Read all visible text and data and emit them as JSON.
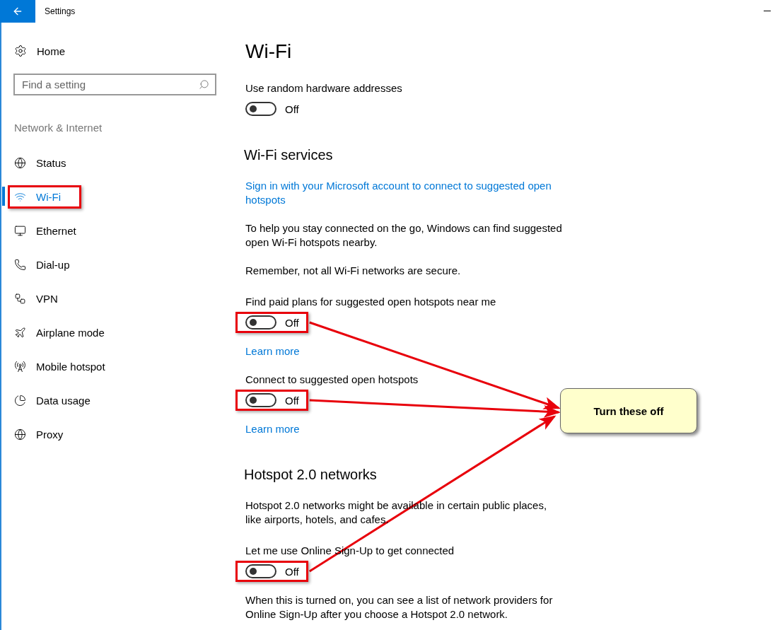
{
  "window": {
    "title": "Settings"
  },
  "sidebar": {
    "home": "Home",
    "search": {
      "placeholder": "Find a setting"
    },
    "section": "Network & Internet",
    "items": [
      {
        "label": "Status",
        "selected": false,
        "highlighted": false
      },
      {
        "label": "Wi-Fi",
        "selected": true,
        "highlighted": true
      },
      {
        "label": "Ethernet",
        "selected": false,
        "highlighted": false
      },
      {
        "label": "Dial-up",
        "selected": false,
        "highlighted": false
      },
      {
        "label": "VPN",
        "selected": false,
        "highlighted": false
      },
      {
        "label": "Airplane mode",
        "selected": false,
        "highlighted": false
      },
      {
        "label": "Mobile hotspot",
        "selected": false,
        "highlighted": false
      },
      {
        "label": "Data usage",
        "selected": false,
        "highlighted": false
      },
      {
        "label": "Proxy",
        "selected": false,
        "highlighted": false
      }
    ]
  },
  "content": {
    "title": "Wi-Fi",
    "items": [
      {
        "kind": "label",
        "text": "Use random hardware addresses"
      },
      {
        "kind": "toggle",
        "on": false,
        "state_text": "Off",
        "highlighted": false
      },
      {
        "kind": "heading",
        "text": "Wi-Fi services"
      },
      {
        "kind": "link",
        "text": "Sign in with your Microsoft account to connect to suggested open hotspots"
      },
      {
        "kind": "paragraph",
        "text": "To help you stay connected on the go, Windows can find suggested open Wi-Fi hotspots nearby."
      },
      {
        "kind": "paragraph",
        "text": "Remember, not all Wi-Fi networks are secure."
      },
      {
        "kind": "label",
        "text": "Find paid plans for suggested open hotspots near me"
      },
      {
        "kind": "toggle",
        "on": false,
        "state_text": "Off",
        "highlighted": true
      },
      {
        "kind": "link",
        "text": "Learn more"
      },
      {
        "kind": "label",
        "text": "Connect to suggested open hotspots"
      },
      {
        "kind": "toggle",
        "on": false,
        "state_text": "Off",
        "highlighted": true
      },
      {
        "kind": "link",
        "text": "Learn more"
      },
      {
        "kind": "heading",
        "text": "Hotspot 2.0 networks"
      },
      {
        "kind": "paragraph",
        "text": "Hotspot 2.0 networks might be available in certain public places, like airports, hotels, and cafes."
      },
      {
        "kind": "label",
        "text": "Let me use Online Sign-Up to get connected"
      },
      {
        "kind": "toggle",
        "on": false,
        "state_text": "Off",
        "highlighted": true
      },
      {
        "kind": "paragraph",
        "text": "When this is turned on, you can see a list of network providers for Online Sign-Up after you choose a Hotspot 2.0 network."
      }
    ]
  },
  "callout": {
    "text": "Turn these off"
  }
}
